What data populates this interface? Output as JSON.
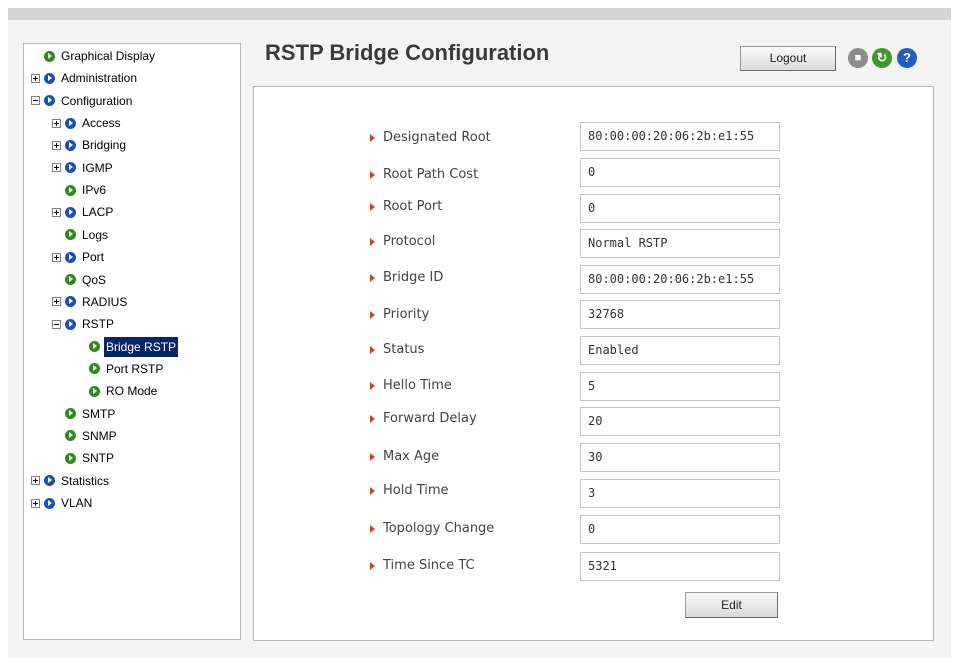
{
  "header": {
    "title": "RSTP Bridge Configuration",
    "logout_label": "Logout",
    "icons": [
      "save-icon",
      "refresh-icon",
      "help-icon"
    ]
  },
  "sidebar": {
    "items": [
      {
        "label": "Graphical Display",
        "expander": "none",
        "level": 0,
        "color": "#2e8a1e"
      },
      {
        "label": "Administration",
        "expander": "plus",
        "level": 0,
        "color": "#1a4fb8"
      },
      {
        "label": "Configuration",
        "expander": "minus",
        "level": 0,
        "color": "#1a4fb8"
      },
      {
        "label": "Access",
        "expander": "plus",
        "level": 1,
        "color": "#1a4fb8"
      },
      {
        "label": "Bridging",
        "expander": "plus",
        "level": 1,
        "color": "#1a4fb8"
      },
      {
        "label": "IGMP",
        "expander": "plus",
        "level": 1,
        "color": "#1a4fb8"
      },
      {
        "label": "IPv6",
        "expander": "none",
        "level": 1,
        "color": "#2e8a1e"
      },
      {
        "label": "LACP",
        "expander": "plus",
        "level": 1,
        "color": "#1a4fb8"
      },
      {
        "label": "Logs",
        "expander": "none",
        "level": 1,
        "color": "#2e8a1e"
      },
      {
        "label": "Port",
        "expander": "plus",
        "level": 1,
        "color": "#1a4fb8"
      },
      {
        "label": "QoS",
        "expander": "none",
        "level": 1,
        "color": "#2e8a1e"
      },
      {
        "label": "RADIUS",
        "expander": "plus",
        "level": 1,
        "color": "#1a4fb8"
      },
      {
        "label": "RSTP",
        "expander": "minus",
        "level": 1,
        "color": "#1a4fb8"
      },
      {
        "label": "Bridge RSTP",
        "expander": "none",
        "level": 2,
        "color": "#2e8a1e",
        "selected": true
      },
      {
        "label": "Port RSTP",
        "expander": "none",
        "level": 2,
        "color": "#2e8a1e"
      },
      {
        "label": "RO Mode",
        "expander": "none",
        "level": 2,
        "color": "#2e8a1e"
      },
      {
        "label": "SMTP",
        "expander": "none",
        "level": 1,
        "color": "#2e8a1e"
      },
      {
        "label": "SNMP",
        "expander": "none",
        "level": 1,
        "color": "#2e8a1e"
      },
      {
        "label": "SNTP",
        "expander": "none",
        "level": 1,
        "color": "#2e8a1e"
      },
      {
        "label": "Statistics",
        "expander": "plus",
        "level": 0,
        "color": "#1a4fb8"
      },
      {
        "label": "VLAN",
        "expander": "plus",
        "level": 0,
        "color": "#1a4fb8"
      }
    ]
  },
  "fields": [
    {
      "label": "Designated Root",
      "value": "80:00:00:20:06:2b:e1:55"
    },
    {
      "label": "Root Path Cost",
      "value": "0"
    },
    {
      "label": "Root Port",
      "value": "0"
    },
    {
      "label": "Protocol",
      "value": "Normal RSTP"
    },
    {
      "label": "Bridge ID",
      "value": "80:00:00:20:06:2b:e1:55"
    },
    {
      "label": "Priority",
      "value": "32768"
    },
    {
      "label": "Status",
      "value": "Enabled"
    },
    {
      "label": "Hello Time",
      "value": "5"
    },
    {
      "label": "Forward Delay",
      "value": "20"
    },
    {
      "label": "Max Age",
      "value": "30"
    },
    {
      "label": "Hold Time",
      "value": "3"
    },
    {
      "label": "Topology Change",
      "value": "0"
    },
    {
      "label": "Time Since TC",
      "value": "5321"
    }
  ],
  "edit_label": "Edit"
}
